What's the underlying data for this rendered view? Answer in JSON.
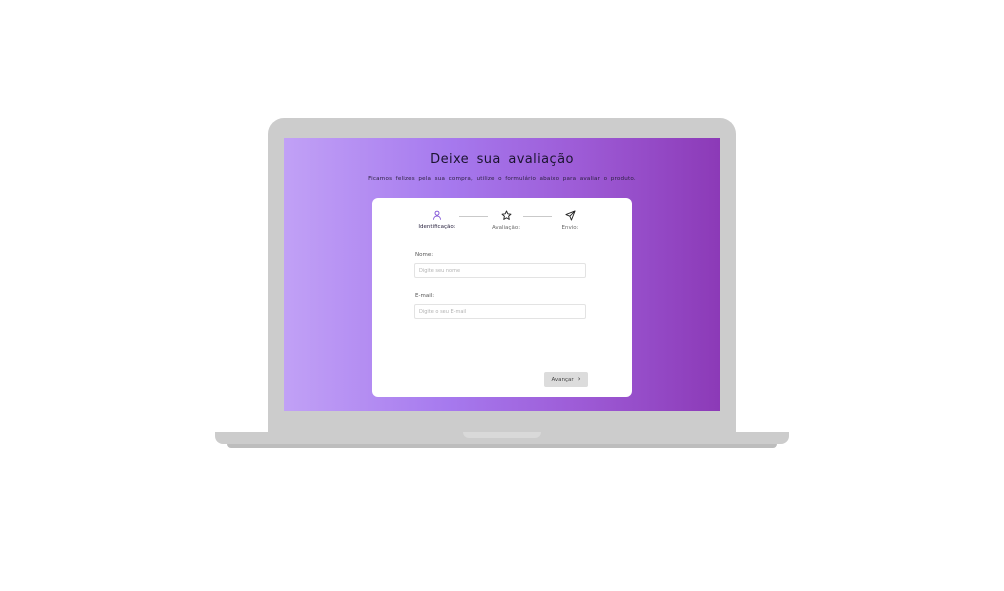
{
  "page": {
    "title": "Deixe sua avaliação",
    "subtitle": "Ficamos felizes pela sua compra, utilize o formulário abaixo para avaliar o produto."
  },
  "steps": [
    {
      "label": "Identificação:",
      "icon": "user-icon",
      "active": true
    },
    {
      "label": "Avaliação:",
      "icon": "star-icon",
      "active": false
    },
    {
      "label": "Envio:",
      "icon": "send-icon",
      "active": false
    }
  ],
  "form": {
    "name_label": "Nome:",
    "name_placeholder": "Digite seu nome",
    "email_label": "E-mail:",
    "email_placeholder": "Digite o seu E-mail"
  },
  "next_button": {
    "label": "Avançar",
    "icon": "chevron-right-icon"
  },
  "colors": {
    "gradient_start": "#c1a1f6",
    "gradient_end": "#8c3ab7",
    "active_step": "#7d4fd6",
    "laptop_body": "#cccccc"
  }
}
